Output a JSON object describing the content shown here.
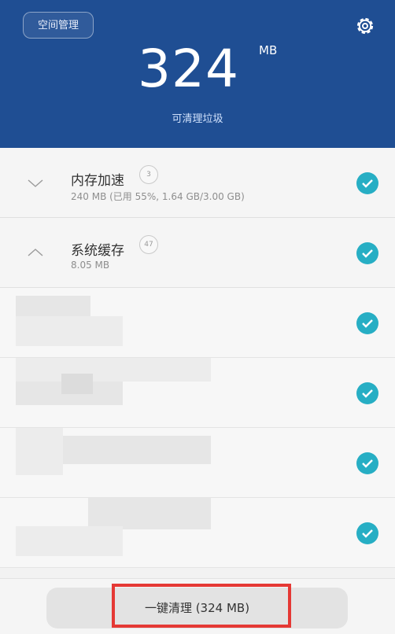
{
  "header": {
    "space_button_label": "空间管理",
    "total_value": "324",
    "total_unit": "MB",
    "subtitle": "可清理垃圾",
    "settings_icon": "gear-icon",
    "background_color": "#1f4e93"
  },
  "items": [
    {
      "title": "内存加速",
      "badge": "3",
      "subtitle": "240 MB (已用 55%, 1.64 GB/3.00 GB)",
      "expanded": false,
      "checked": true
    },
    {
      "title": "系统缓存",
      "badge": "47",
      "subtitle": "8.05 MB",
      "expanded": true,
      "checked": true
    }
  ],
  "blurred_rows_checked": [
    true,
    true,
    true,
    true
  ],
  "bottom": {
    "clean_button_label": "一键清理 (324 MB)"
  },
  "colors": {
    "accent": "#27aec4",
    "highlight_box": "#e53935"
  }
}
